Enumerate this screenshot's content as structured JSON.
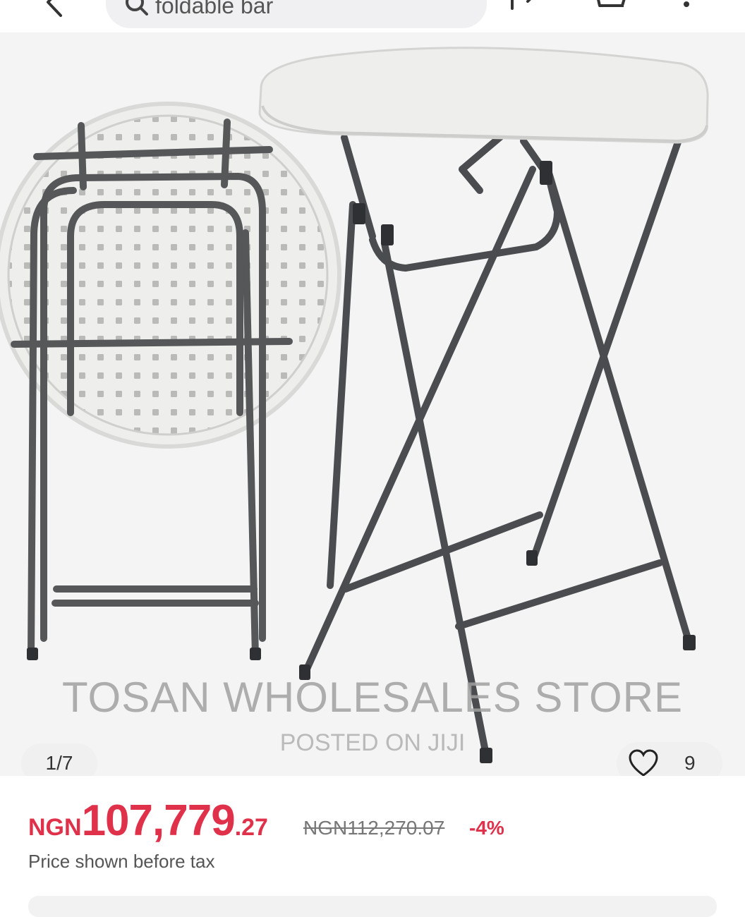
{
  "search": {
    "query": "foldable bar"
  },
  "gallery": {
    "counter": "1/7",
    "watermark_title": "TOSAN WHOLESALES STORE",
    "watermark_sub": "POSTED ON JIJI",
    "likes": "9"
  },
  "price": {
    "currency": "NGN",
    "main": "107,779",
    "decimals": ".27",
    "old": "NGN112,270.07",
    "discount": "-4%",
    "note": "Price shown before tax"
  },
  "colors": {
    "accent": "#e0314a",
    "frame": "#4a4c50",
    "tabletop": "#eeeeec"
  }
}
